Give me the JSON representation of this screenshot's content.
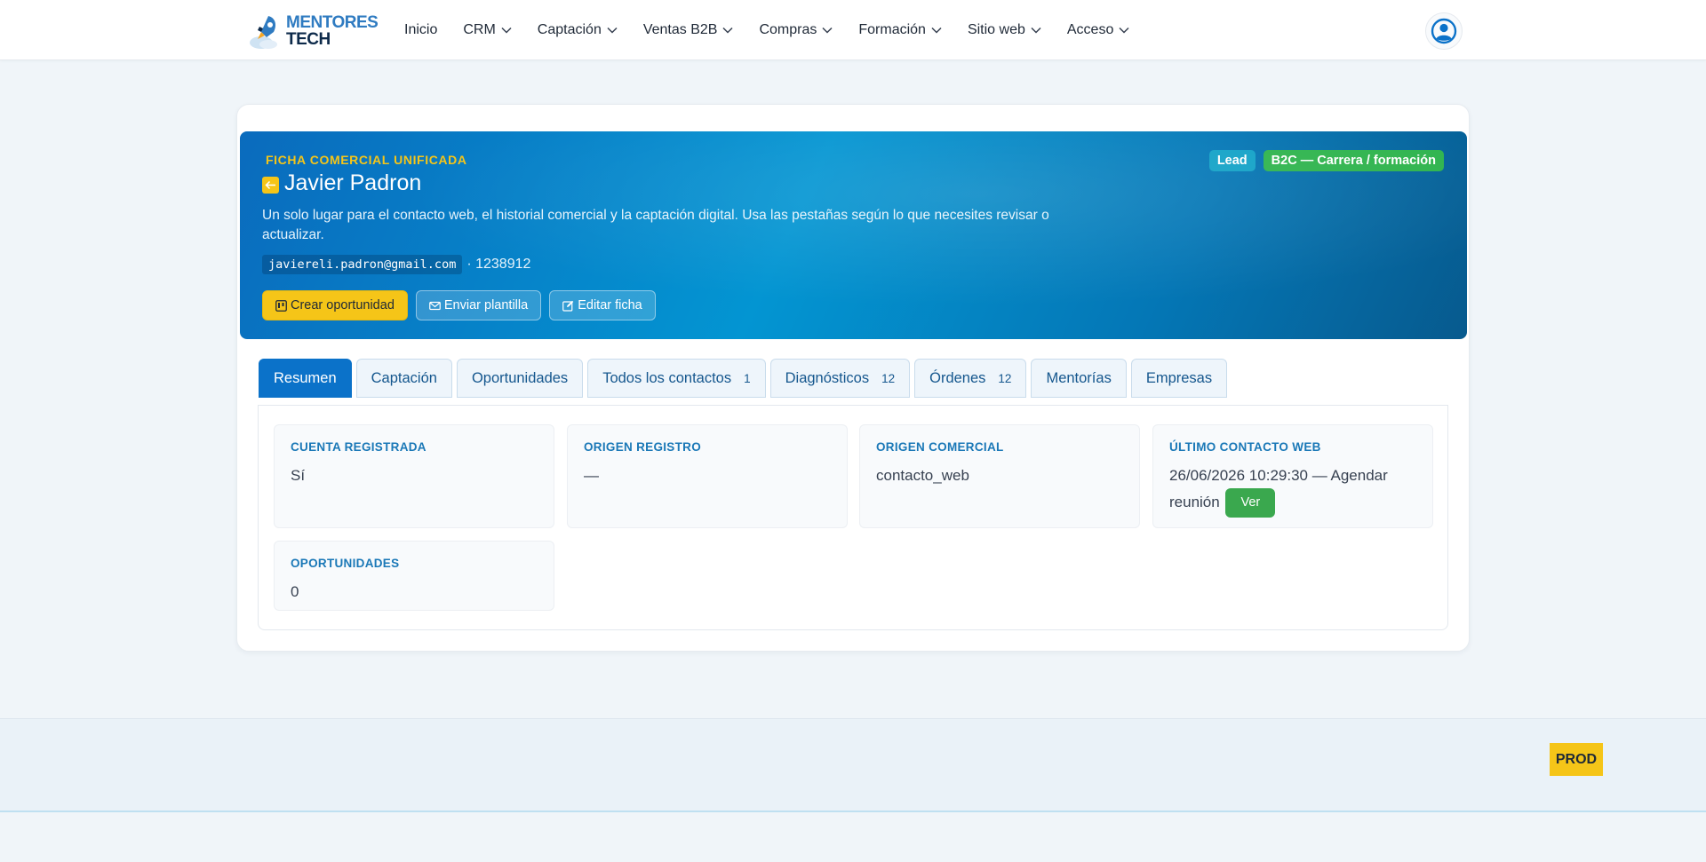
{
  "brand": {
    "logo_line1": "MENTORES",
    "logo_line2": "TECH",
    "primary_color": "#0b72c9",
    "accent_color": "#f5c518"
  },
  "nav": {
    "items": [
      {
        "label": "Inicio",
        "dropdown": false
      },
      {
        "label": "CRM",
        "dropdown": true
      },
      {
        "label": "Captación",
        "dropdown": true
      },
      {
        "label": "Ventas B2B",
        "dropdown": true
      },
      {
        "label": "Compras",
        "dropdown": true
      },
      {
        "label": "Formación",
        "dropdown": true
      },
      {
        "label": "Sitio web",
        "dropdown": true
      },
      {
        "label": "Acceso",
        "dropdown": true
      }
    ],
    "user_icon": "user-circle-icon"
  },
  "hero": {
    "eyebrow": "FICHA COMERCIAL UNIFICADA",
    "name": "Javier Padron",
    "description": "Un solo lugar para el contacto web, el historial comercial y la captación digital. Usa las pestañas según lo que necesites revisar o actualizar.",
    "email": "javiereli.padron@gmail.com",
    "phone": "· 1238912",
    "badges": [
      {
        "label": "Lead",
        "color": "#12a2c7"
      },
      {
        "label": "B2C — Carrera / formación",
        "color": "#2fb44e"
      }
    ],
    "actions": {
      "create_opportunity": "Crear oportunidad",
      "send_template": "Enviar plantilla",
      "edit_record": "Editar ficha"
    }
  },
  "tabs": [
    {
      "label": "Resumen",
      "count": "",
      "active": true
    },
    {
      "label": "Captación",
      "count": "",
      "active": false
    },
    {
      "label": "Oportunidades",
      "count": "",
      "active": false
    },
    {
      "label": "Todos los contactos",
      "count": "1",
      "active": false
    },
    {
      "label": "Diagnósticos",
      "count": "12",
      "active": false
    },
    {
      "label": "Órdenes",
      "count": "12",
      "active": false
    },
    {
      "label": "Mentorías",
      "count": "",
      "active": false
    },
    {
      "label": "Empresas",
      "count": "",
      "active": false
    }
  ],
  "summary": {
    "registered_account": {
      "label": "CUENTA REGISTRADA",
      "value": "Sí"
    },
    "registration_origin": {
      "label": "ORIGEN REGISTRO",
      "value": "—"
    },
    "commercial_origin": {
      "label": "ORIGEN COMERCIAL",
      "value": "contacto_web"
    },
    "last_web_contact": {
      "label": "ÚLTIMO CONTACTO WEB",
      "value": "26/06/2026 10:29:30 — Agendar reunión",
      "action": "Ver"
    },
    "opportunities": {
      "label": "OPORTUNIDADES",
      "value": "0"
    }
  },
  "footer": {
    "env_badge": "PROD"
  }
}
